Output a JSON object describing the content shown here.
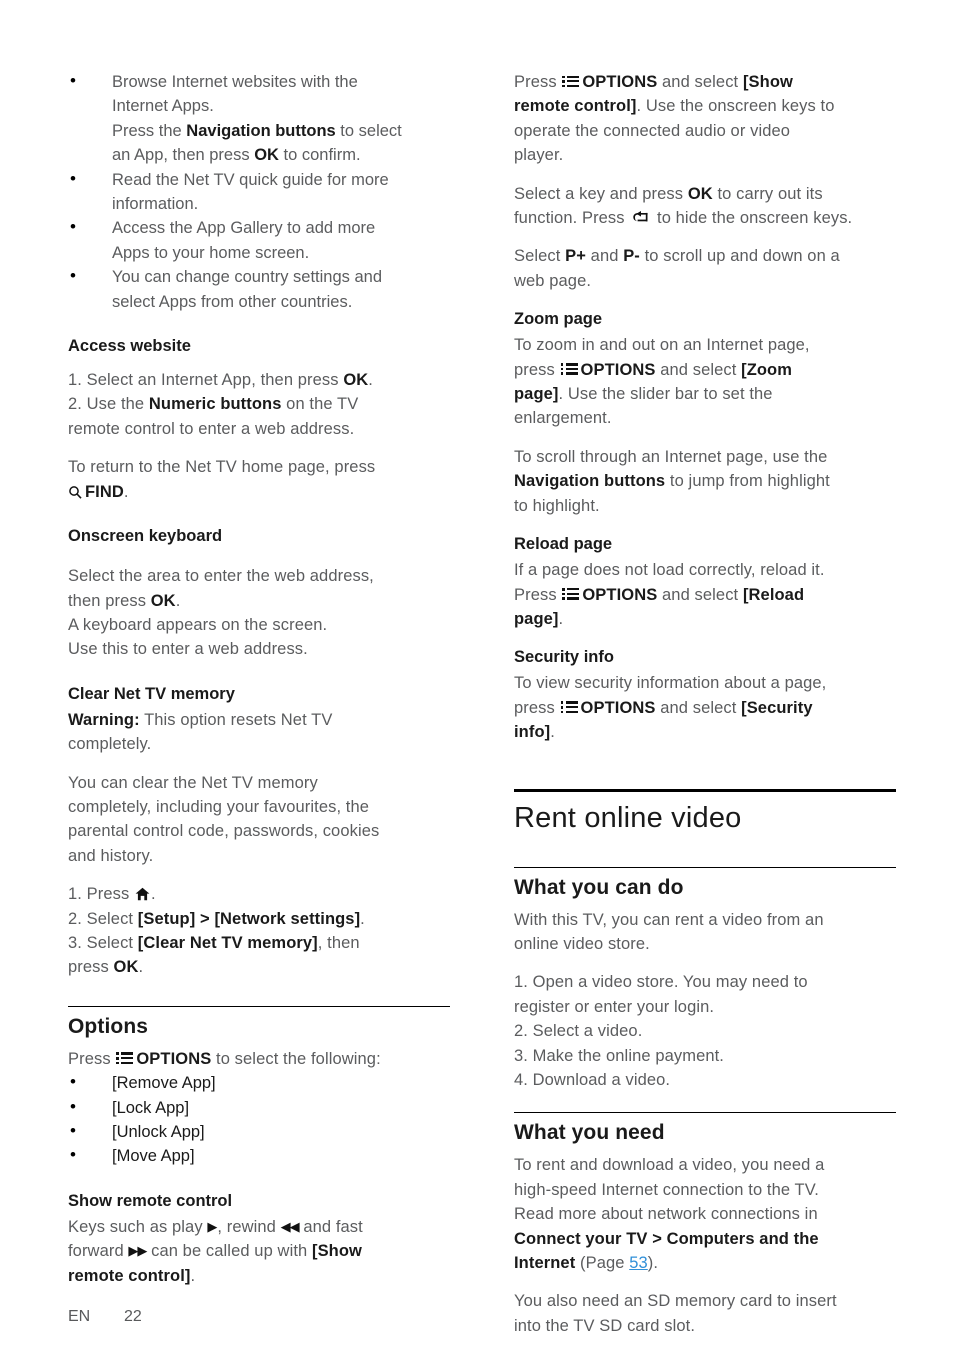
{
  "document": {
    "footer": {
      "language": "EN",
      "page_number": "22"
    },
    "icons": {
      "options": "options-list-icon",
      "home": "home-icon",
      "back": "back-arrow-icon",
      "search": "search-icon",
      "play": "▶",
      "rewind": "◀◀",
      "forward": "▶▶"
    }
  },
  "left_column": {
    "intro_bullets": [
      {
        "l1": "Browse Internet websites with the",
        "l2": "Internet Apps.",
        "l3_pre": "Press the ",
        "l3_bold": "Navigation buttons",
        "l3_post": " to select",
        "l4_pre": "an App, then press ",
        "l4_bold": "OK",
        "l4_post": " to confirm."
      },
      {
        "l1": "Read the Net TV quick guide for more",
        "l2": "information."
      },
      {
        "l1": "Access the App Gallery to add more",
        "l2": "Apps to your home screen."
      },
      {
        "l1": "You can change country settings and",
        "l2": "select Apps from other countries."
      }
    ],
    "access_website": {
      "heading": "Access website",
      "step1_pre": "1. Select an Internet App, then press ",
      "step1_bold": "OK",
      "step1_post": ".",
      "step2_pre": "2. Use the ",
      "step2_bold": "Numeric buttons",
      "step2_post": " on the TV",
      "step2_line2": "remote control to enter a web address.",
      "return_line1": "To return to the Net TV home page, press",
      "return_find": "FIND",
      "return_period": "."
    },
    "onscreen_keyboard": {
      "heading": "Onscreen keyboard",
      "p1_pre": "Select the area to enter the web address,",
      "p1_line2_pre": "then press ",
      "p1_line2_bold": "OK",
      "p1_line2_post": ".",
      "p2_line1": "A keyboard appears on the screen.",
      "p2_line2": "Use this to enter a web address."
    },
    "clear_memory": {
      "heading": "Clear Net TV memory",
      "warning_bold": "Warning:",
      "warning_text": " This option resets Net TV",
      "warning_line2": "completely.",
      "p1_line1": "You can clear the Net TV memory",
      "p1_line2": "completely, including your favourites, the",
      "p1_line3": "parental control code, passwords, cookies",
      "p1_line4": "and history.",
      "step1_pre": "1. Press ",
      "step1_post": ".",
      "step2_pre": "2. Select ",
      "step2_b1": "[Setup]",
      "step2_mid": " > ",
      "step2_b2": "[Network settings]",
      "step2_post": ".",
      "step3_pre": "3. Select ",
      "step3_b1": "[Clear Net TV memory]",
      "step3_post": ", then",
      "step3_line2_pre": "press ",
      "step3_line2_bold": "OK",
      "step3_line2_post": "."
    },
    "options": {
      "heading": "Options",
      "intro_pre": "Press ",
      "intro_bold": "OPTIONS",
      "intro_post": " to select the following:",
      "items": [
        "[Remove App]",
        "[Lock App]",
        "[Unlock App]",
        "[Move App]"
      ]
    },
    "show_remote": {
      "heading": "Show remote control",
      "l1_a": "Keys such as play ",
      "l1_b": ", rewind ",
      "l1_c": " and fast",
      "l2_a": "forward ",
      "l2_b": " can be called up with ",
      "l2_bold": "[Show",
      "l3_bold": "remote control]",
      "l3_post": "."
    }
  },
  "right_column": {
    "show_remote_cont": {
      "p1_pre": "Press ",
      "p1_bold1": "OPTIONS",
      "p1_mid": " and select ",
      "p1_bold2": "[Show",
      "p1_line2_bold": "remote control]",
      "p1_line2_post": ". Use the onscreen keys to",
      "p1_line3": "operate the connected audio or video",
      "p1_line4": "player.",
      "p2_pre": "Select a key and press ",
      "p2_bold": "OK",
      "p2_post": " to carry out its",
      "p2_line2_pre": "function. Press ",
      "p2_line2_post": " to hide the onscreen keys.",
      "p3_pre": "Select ",
      "p3_b1": "P+",
      "p3_mid": " and ",
      "p3_b2": "P-",
      "p3_post": " to scroll up and down on a",
      "p3_line2": "web page."
    },
    "zoom_page": {
      "heading": "Zoom page",
      "l1": "To zoom in and out on an Internet page,",
      "l2_pre": "press ",
      "l2_bold1": "OPTIONS",
      "l2_mid": " and select ",
      "l2_bold2": "[Zoom",
      "l3_bold": "page]",
      "l3_post": ". Use the slider bar to set the",
      "l4": "enlargement.",
      "p2_l1": "To scroll through an Internet page, use the",
      "p2_l2_bold": "Navigation buttons",
      "p2_l2_post": " to jump from highlight",
      "p2_l3": "to highlight."
    },
    "reload_page": {
      "heading": "Reload page",
      "l1": "If a page does not load correctly, reload it.",
      "l2_pre": "Press ",
      "l2_bold1": "OPTIONS",
      "l2_mid": " and select ",
      "l2_bold2": "[Reload",
      "l3_bold": "page]",
      "l3_post": "."
    },
    "security_info": {
      "heading": "Security info",
      "l1": "To view security information about a page,",
      "l2_pre": "press ",
      "l2_bold1": "OPTIONS",
      "l2_mid": " and select ",
      "l2_bold2": "[Security",
      "l3_bold": "info]",
      "l3_post": "."
    },
    "rent_online_video": {
      "title": "Rent online video",
      "what_you_can_do": {
        "heading": "What you can do",
        "p1_l1": "With this TV, you can rent a video from an",
        "p1_l2": "online video store.",
        "steps": [
          "1. Open a video store. You may need to",
          "register or enter your login.",
          "2. Select a video.",
          "3. Make the online payment.",
          "4. Download a video."
        ]
      },
      "what_you_need": {
        "heading": "What you need",
        "l1": "To rent and download a video, you need a",
        "l2": "high-speed Internet connection to the TV.",
        "l3": "Read more about network connections in",
        "l4_bold": "Connect your TV > Computers and the",
        "l5_bold": "Internet",
        "l5_mid": " (Page ",
        "l5_link": "53",
        "l5_post": ").",
        "p2_l1": "You also need an SD memory card to insert",
        "p2_l2": "into the TV SD card slot."
      }
    }
  }
}
